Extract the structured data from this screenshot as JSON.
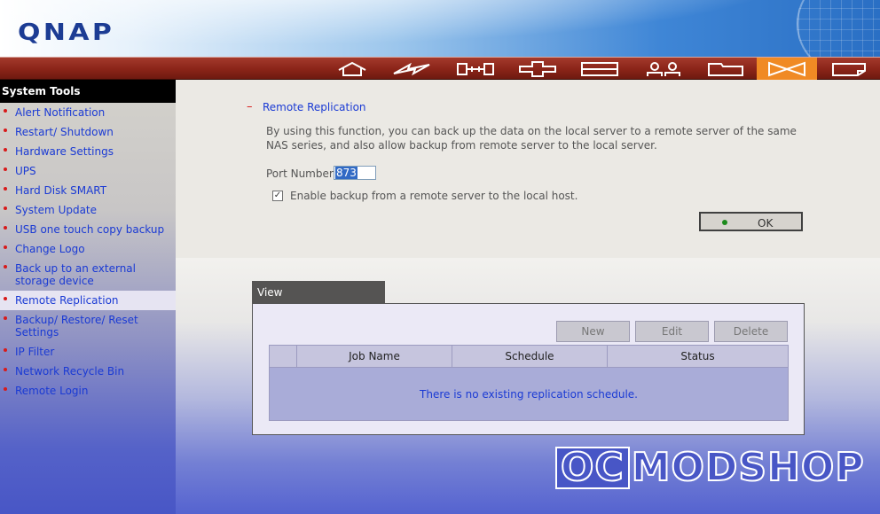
{
  "header": {
    "logo_text": "QNAP"
  },
  "nav": {
    "icons": [
      "home-icon",
      "lightning-icon",
      "network-icon",
      "cross-icon",
      "disk-icon",
      "users-icon",
      "folder-icon",
      "tools-icon",
      "notes-icon"
    ],
    "active_index": 7,
    "active_color": "#f08a24"
  },
  "sidebar": {
    "title": "System Tools",
    "items": [
      {
        "label": "Alert Notification"
      },
      {
        "label": "Restart/ Shutdown"
      },
      {
        "label": "Hardware Settings"
      },
      {
        "label": "UPS"
      },
      {
        "label": "Hard Disk SMART"
      },
      {
        "label": "System Update"
      },
      {
        "label": "USB one touch copy backup"
      },
      {
        "label": "Change Logo"
      },
      {
        "label": "Back up to an external storage device"
      },
      {
        "label": "Remote Replication",
        "selected": true
      },
      {
        "label": "Backup/ Restore/ Reset Settings"
      },
      {
        "label": "IP Filter"
      },
      {
        "label": "Network Recycle Bin"
      },
      {
        "label": "Remote Login"
      }
    ]
  },
  "main": {
    "section_marker": "–",
    "section_title": "Remote Replication",
    "description": "By using this function, you can back up the data on the local server to a remote server of the same NAS series, and also allow backup from remote server to the local server.",
    "port_label": "Port Number:",
    "port_value": "873",
    "backup_checkbox_label": "Enable backup from a remote server to the local host.",
    "backup_checked": true,
    "ok_label": "OK"
  },
  "view": {
    "tab_label": "View",
    "buttons": {
      "new": "New",
      "edit": "Edit",
      "delete": "Delete"
    },
    "columns": [
      "Job Name",
      "Schedule",
      "Status"
    ],
    "empty_message": "There is no existing replication schedule."
  },
  "watermark": {
    "part1": "OC",
    "part2": "MODSHOP"
  }
}
